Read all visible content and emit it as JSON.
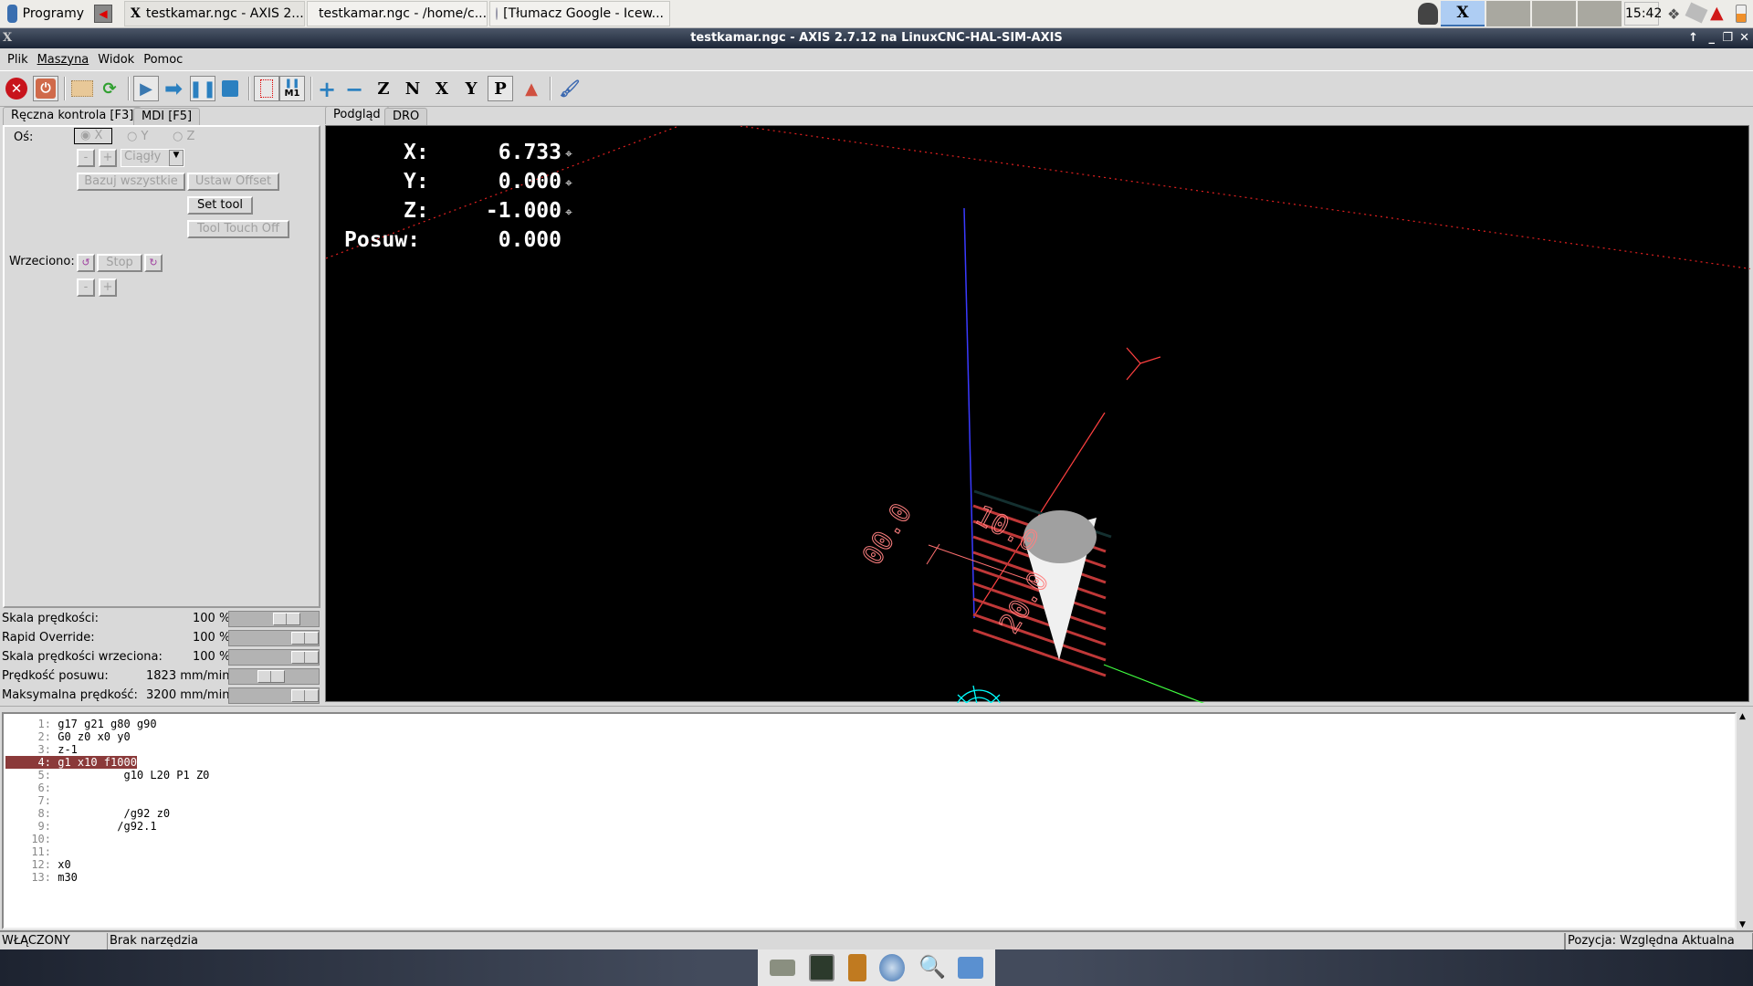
{
  "taskbar": {
    "start_label": "Programy",
    "tasks": [
      {
        "label": "testkamar.ngc - AXIS 2....",
        "icon": "x-app-icon",
        "active": true
      },
      {
        "label": "testkamar.ngc - /home/c...",
        "icon": "editor-icon",
        "active": false
      },
      {
        "label": "[Tłumacz Google - Icew...",
        "icon": "browser-icon",
        "active": false
      }
    ],
    "workspace_label": "X",
    "clock": "15:42",
    "tray_icons": [
      "dropbox-icon",
      "network-icon",
      "warning-icon",
      "battery-icon"
    ]
  },
  "window": {
    "title": "testkamar.ngc - AXIS 2.7.12 na LinuxCNC-HAL-SIM-AXIS"
  },
  "menu": [
    "Plik",
    "Maszyna",
    "Widok",
    "Pomoc"
  ],
  "toolbar": [
    "estop-icon",
    "machine-power-icon",
    "open-file-icon",
    "reload-icon",
    "run-icon",
    "step-icon",
    "pause-icon",
    "stop-icon",
    "block-delete-icon",
    "optional-stop-icon",
    "zoom-in-icon",
    "zoom-out-icon",
    "view-z-icon",
    "view-z2-icon",
    "view-x-icon",
    "view-y-icon",
    "view-perspective-icon",
    "rotate-view-icon",
    "clear-plot-icon"
  ],
  "toolbar_text": {
    "z": "Z",
    "n": "N",
    "x": "X",
    "y": "Y",
    "p": "P",
    "m1": "M1"
  },
  "left_tabs": [
    "Ręczna kontrola [F3]",
    "MDI [F5]"
  ],
  "manual": {
    "axis_label": "Oś:",
    "axes": [
      "X",
      "Y",
      "Z"
    ],
    "selected_axis": "X",
    "minus": "-",
    "plus": "+",
    "jog_mode": "Ciągły",
    "home_all": "Bazuj wszystkie",
    "touch_off": "Ustaw Offset",
    "set_tool": "Set tool",
    "tool_touch_off": "Tool Touch Off",
    "spindle_label": "Wrzeciono:",
    "spindle_stop": "Stop"
  },
  "overrides": [
    {
      "label": "Skala prędkości:",
      "value": "100 %",
      "fraction": 0.7
    },
    {
      "label": "Rapid Override:",
      "value": "100 %",
      "fraction": 1.0
    },
    {
      "label": "Skala prędkości wrzeciona:",
      "value": "100 %",
      "fraction": 1.0
    },
    {
      "label": "Prędkość posuwu:",
      "value": "1823 mm/min",
      "fraction": 0.45
    },
    {
      "label": "Maksymalna prędkość:",
      "value": "3200 mm/min",
      "fraction": 1.0
    }
  ],
  "view_tabs": [
    "Podgląd",
    "DRO"
  ],
  "dro": [
    {
      "label": "X:",
      "value": "6.733"
    },
    {
      "label": "Y:",
      "value": "0.000"
    },
    {
      "label": "Z:",
      "value": "-1.000"
    },
    {
      "label": "Posuw:",
      "value": "0.000"
    }
  ],
  "plot_labels": {
    "a": "00.0",
    "b": "10.0",
    "c": "20.0"
  },
  "colors": {
    "highlight": "#8b3a3a",
    "feed": "#ff3030",
    "tool": "#ffffff",
    "x_axis": "#ff4040",
    "y_axis": "#40ff40",
    "z_axis": "#4040ff",
    "origin": "#00ffff"
  },
  "code": [
    {
      "n": "1:",
      "t": "g17 g21 g80 g90"
    },
    {
      "n": "2:",
      "t": "G0 z0 x0 y0"
    },
    {
      "n": "3:",
      "t": "z-1"
    },
    {
      "n": "4:",
      "t": "g1 x10 f1000",
      "active": true
    },
    {
      "n": "5:",
      "t": "          g10 L20 P1 Z0"
    },
    {
      "n": "6:",
      "t": ""
    },
    {
      "n": "7:",
      "t": ""
    },
    {
      "n": "8:",
      "t": "          /g92 z0"
    },
    {
      "n": "9:",
      "t": "         /g92.1"
    },
    {
      "n": "10:",
      "t": ""
    },
    {
      "n": "11:",
      "t": ""
    },
    {
      "n": "12:",
      "t": "x0"
    },
    {
      "n": "13:",
      "t": "m30"
    }
  ],
  "status": {
    "state": "WŁĄCZONY",
    "tool": "Brak narzędzia",
    "position": "Pozycja: Względna Aktualna"
  },
  "dock": [
    "drive-icon",
    "terminal-icon",
    "file-cabinet-icon",
    "web-browser-icon",
    "search-icon",
    "folder-icon"
  ]
}
